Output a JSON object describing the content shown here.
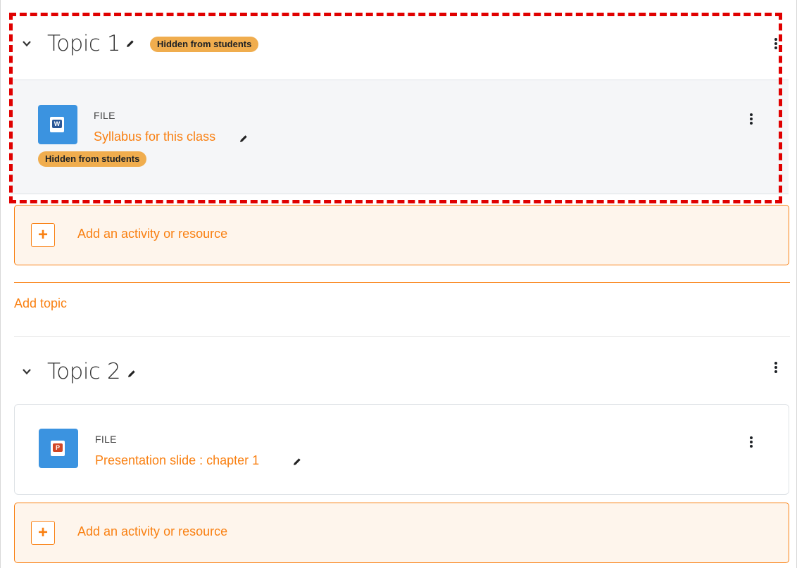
{
  "sections": [
    {
      "title": "Topic 1",
      "badge": "Hidden from students",
      "activity": {
        "type": "FILE",
        "name": "Syllabus for this class",
        "badge": "Hidden from students",
        "icon": "word-document-icon"
      },
      "add_label": "Add an activity or resource"
    },
    {
      "title": "Topic 2",
      "activity": {
        "type": "FILE",
        "name": "Presentation slide : chapter 1",
        "icon": "powerpoint-document-icon"
      },
      "add_label": "Add an activity or resource"
    }
  ],
  "add_topic_label": "Add topic",
  "colors": {
    "accent": "#f98012",
    "badge": "#f0ad4e",
    "highlight": "#e00000",
    "file_icon_bg": "#3b93e0"
  }
}
